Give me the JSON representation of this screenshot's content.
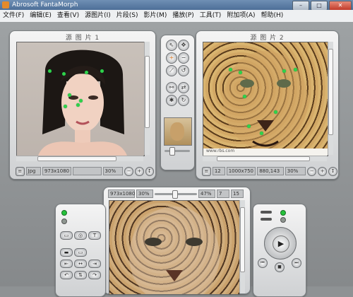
{
  "window": {
    "title": "Abrosoft FantaMorph",
    "minimize": "–",
    "maximize": "□",
    "close": "✕"
  },
  "menu": [
    "文件(F)",
    "编辑(E)",
    "查看(V)",
    "源图片(I)",
    "片段(S)",
    "影片(M)",
    "播放(P)",
    "工具(T)",
    "附加项(A)",
    "帮助(H)"
  ],
  "source1": {
    "title": "源 图 片 1",
    "format": "Jpg",
    "size": "973x1080",
    "zoom": "30%"
  },
  "source2": {
    "title": "源 图 片 2",
    "index": "12",
    "size": "1000x750",
    "coords": "880,143",
    "zoom": "30%",
    "watermark": "www.rbs.com"
  },
  "preview": {
    "size": "973x1080",
    "zoom": "30%",
    "progress": "47%",
    "frame": "7",
    "total": "15",
    "slider_level": 0.47
  },
  "colors": {
    "marker": "#2fd24a",
    "panel": "#e6e7e8",
    "titlebar": "#5a7ca5"
  }
}
